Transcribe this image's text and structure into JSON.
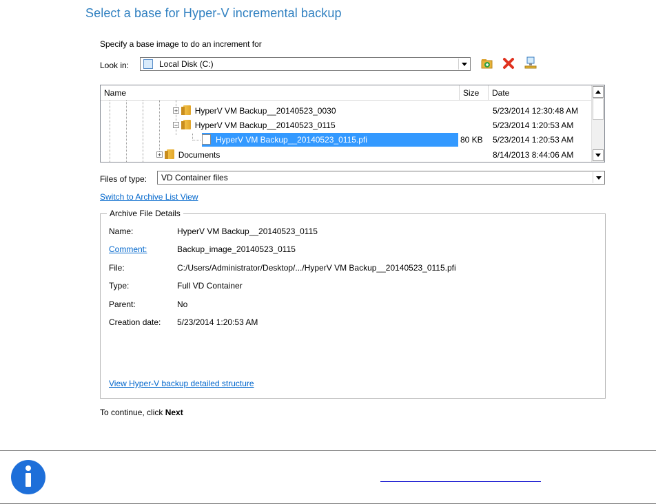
{
  "title": "Select a base for Hyper-V incremental backup",
  "specify_label": "Specify a base image to do an increment for",
  "look_in": {
    "label": "Look in:",
    "value": "Local Disk (C:)"
  },
  "columns": {
    "name": "Name",
    "size": "Size",
    "date": "Date"
  },
  "tree_rows": [
    {
      "name": "HyperV VM Backup__20140523_0030",
      "size": "",
      "date": "5/23/2014 12:30:48 AM",
      "expander": "+"
    },
    {
      "name": "HyperV VM Backup__20140523_0115",
      "size": "",
      "date": "5/23/2014 1:20:53 AM",
      "expander": "−"
    },
    {
      "name": "HyperV VM Backup__20140523_0115.pfi",
      "size": "80 KB",
      "date": "5/23/2014 1:20:53 AM",
      "selected": true
    },
    {
      "name": "Documents",
      "size": "",
      "date": "8/14/2013 8:44:06 AM",
      "expander": "+"
    }
  ],
  "files_of_type": {
    "label": "Files of type:",
    "value": "VD Container files"
  },
  "switch_link": "Switch to Archive List View",
  "details": {
    "legend": "Archive File Details",
    "name_label": "Name:",
    "name_value": "HyperV VM Backup__20140523_0115",
    "comment_label": "Comment:",
    "comment_value": "Backup_image_20140523_0115",
    "file_label": "File:",
    "file_value": "C:/Users/Administrator/Desktop/.../HyperV VM Backup__20140523_0115.pfi",
    "type_label": "Type:",
    "type_value": "Full VD Container",
    "parent_label": "Parent:",
    "parent_value": "No",
    "created_label": "Creation date:",
    "created_value": "5/23/2014 1:20:53 AM",
    "structure_link": "View Hyper-V backup detailed structure"
  },
  "continue_text": "To continue, click ",
  "continue_bold": "Next",
  "colors": {
    "title": "#2e7fc0",
    "selection": "#3399ff",
    "link": "#0066cc",
    "info_icon": "#1e6fd9"
  }
}
